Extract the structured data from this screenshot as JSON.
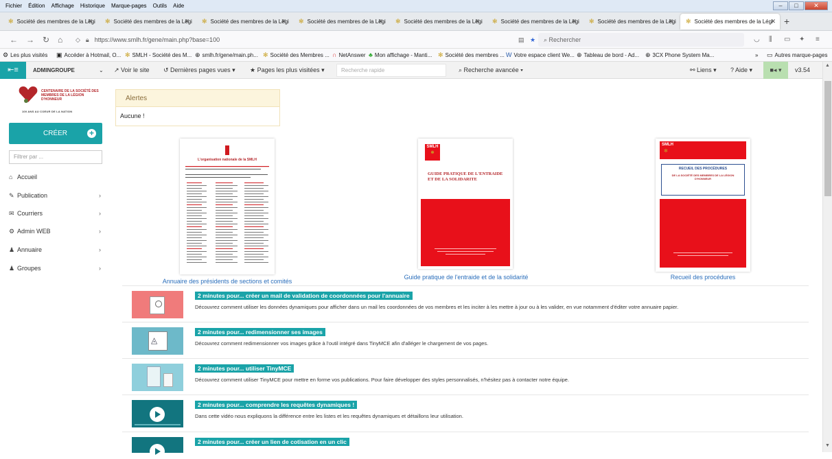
{
  "menubar": {
    "items": [
      "Fichier",
      "Édition",
      "Affichage",
      "Historique",
      "Marque-pages",
      "Outils",
      "Aide"
    ]
  },
  "tabs": [
    {
      "title": "Société des membres de la Légi",
      "active": false
    },
    {
      "title": "Société des membres de la Légi",
      "active": false
    },
    {
      "title": "Société des membres de la Légi",
      "active": false
    },
    {
      "title": "Société des membres de la Légi",
      "active": false
    },
    {
      "title": "Société des membres de la Légi",
      "active": false
    },
    {
      "title": "Société des membres de la Légi",
      "active": false
    },
    {
      "title": "Société des membres de la Légi",
      "active": false
    },
    {
      "title": "Société des membres de la Légi",
      "active": true
    }
  ],
  "navbar": {
    "url": "https://www.smlh.fr/gene/main.php?base=100",
    "search_placeholder": "Rechercher"
  },
  "bookmarks": [
    "Les plus visités",
    "Accéder à Hotmail, O...",
    "SMLH - Société des M...",
    "smlh.fr/gene/main.ph...",
    "Société des Membres ...",
    "NetAnswer",
    "Mon affichage - Manti...",
    "Société des membres ...",
    "Votre espace client We...",
    "Tableau de bord - Ad...",
    "3CX Phone System Ma...",
    "Autres marque-pages"
  ],
  "toolbar": {
    "group": "ADMINGROUPE",
    "view_site": "Voir le site",
    "last_pages": "Dernières pages vues",
    "most_visited": "Pages les plus visitées",
    "quick_search_placeholder": "Recherche rapide",
    "advanced_search": "Recherche avancée",
    "links": "Liens",
    "help": "Aide",
    "version": "v3.54"
  },
  "sidebar": {
    "logo_text": "CENTENAIRE DE LA SOCIÉTÉ DES MEMBRES DE LA LÉGION D'HONNEUR",
    "logo_subtext": "100 ANS AU COEUR DE LA NATION",
    "create_label": "CRÉER",
    "filter_placeholder": "Filtrer par ...",
    "items": [
      {
        "label": "Accueil",
        "icon": "home-icon",
        "has_children": false
      },
      {
        "label": "Publication",
        "icon": "edit-icon",
        "has_children": true
      },
      {
        "label": "Courriers",
        "icon": "envelope-icon",
        "has_children": true
      },
      {
        "label": "Admin WEB",
        "icon": "gear-icon",
        "has_children": true
      },
      {
        "label": "Annuaire",
        "icon": "user-icon",
        "has_children": true
      },
      {
        "label": "Groupes",
        "icon": "users-icon",
        "has_children": true
      }
    ]
  },
  "alerts": {
    "title": "Alertes",
    "body": "Aucune !"
  },
  "documents": [
    {
      "caption": "Annuaire des présidents de sections et comités",
      "cover_title": "L'organisation nationale de la SMLH"
    },
    {
      "caption": "Guide pratique de l'entraide et de la solidarité",
      "cover_title": "GUIDE PRATIQUE DE L'ENTRAIDE ET DE LA SOLIDARITE",
      "brand": "SMLH"
    },
    {
      "caption": "Recueil des procédures",
      "cover_title": "RECUEIL DES PROCÉDURES",
      "cover_subtitle": "DE LA SOCIÉTÉ DES MEMBRES DE LA LÉGION D'HONNEUR",
      "brand": "SMLH"
    }
  ],
  "tutorials": [
    {
      "title": "2 minutes pour... créer un mail de validation de coordonnées pour l'annuaire",
      "description": "Découvrez comment utiliser les données dynamiques pour afficher dans un mail les coordonnées de vos membres et les inciter à les mettre à jour ou à les valider, en vue notamment d'éditer votre annuaire papier."
    },
    {
      "title": "2 minutes pour... redimensionner ses images",
      "description": "Découvrez comment redimensionner vos images grâce à l'outil intégré dans TinyMCE afin d'alléger le chargement de vos pages."
    },
    {
      "title": "2 minutes pour... utiliser TinyMCE",
      "description": "Découvrez comment utiliser TinyMCE pour mettre en forme vos publications. Pour faire développer des styles personnalisés, n'hésitez pas à contacter notre équipe."
    },
    {
      "title": "2 minutes pour... comprendre les requêtes dynamiques !",
      "description": "Dans cette vidéo nous expliquons la différence entre les listes et les requêtes dynamiques et détaillons leur utilisation."
    },
    {
      "title": "2 minutes pour... créer un lien de cotisation en un clic",
      "description": ""
    }
  ],
  "colors": {
    "accent": "#1aa3a8",
    "brand_red": "#e8101a",
    "link": "#2a6ebb"
  }
}
